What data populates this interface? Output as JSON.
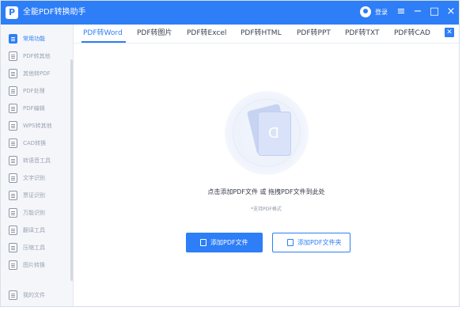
{
  "app": {
    "title": "全能PDF转换助手",
    "login_label": "登录"
  },
  "window_controls": {
    "menu_icon": "menu-icon",
    "minimize_icon": "minimize-icon",
    "maximize_icon": "maximize-icon",
    "close_icon": "close-icon"
  },
  "sidebar": {
    "items": [
      {
        "label": "常用功能",
        "active": true
      },
      {
        "label": "PDF转其他",
        "active": false
      },
      {
        "label": "其他转PDF",
        "active": false
      },
      {
        "label": "PDF处理",
        "active": false
      },
      {
        "label": "PDF编辑",
        "active": false
      },
      {
        "label": "WPS转其他",
        "active": false
      },
      {
        "label": "CAD转换",
        "active": false
      },
      {
        "label": "转语音工具",
        "active": false
      },
      {
        "label": "文字识别",
        "active": false
      },
      {
        "label": "票证识别",
        "active": false
      },
      {
        "label": "万能识别",
        "active": false
      },
      {
        "label": "翻译工具",
        "active": false
      },
      {
        "label": "压缩工具",
        "active": false
      },
      {
        "label": "图片转换",
        "active": false
      },
      {
        "label": "我的文件",
        "active": false
      }
    ]
  },
  "tabs": [
    {
      "label": "PDF转Word",
      "active": true
    },
    {
      "label": "PDF转图片",
      "active": false
    },
    {
      "label": "PDF转Excel",
      "active": false
    },
    {
      "label": "PDF转HTML",
      "active": false
    },
    {
      "label": "PDF转PPT",
      "active": false
    },
    {
      "label": "PDF转TXT",
      "active": false
    },
    {
      "label": "PDF转CAD",
      "active": false
    }
  ],
  "drop_zone": {
    "hint": "点击添加PDF文件 或 拖拽PDF文件到此处",
    "sub_hint": "*支持PDF格式",
    "add_file_label": "添加PDF文件",
    "add_folder_label": "添加PDF文件夹"
  },
  "colors": {
    "accent": "#2d7ef7",
    "sidebar_bg": "#f4f6fa",
    "text_muted": "#9aa3b2"
  }
}
